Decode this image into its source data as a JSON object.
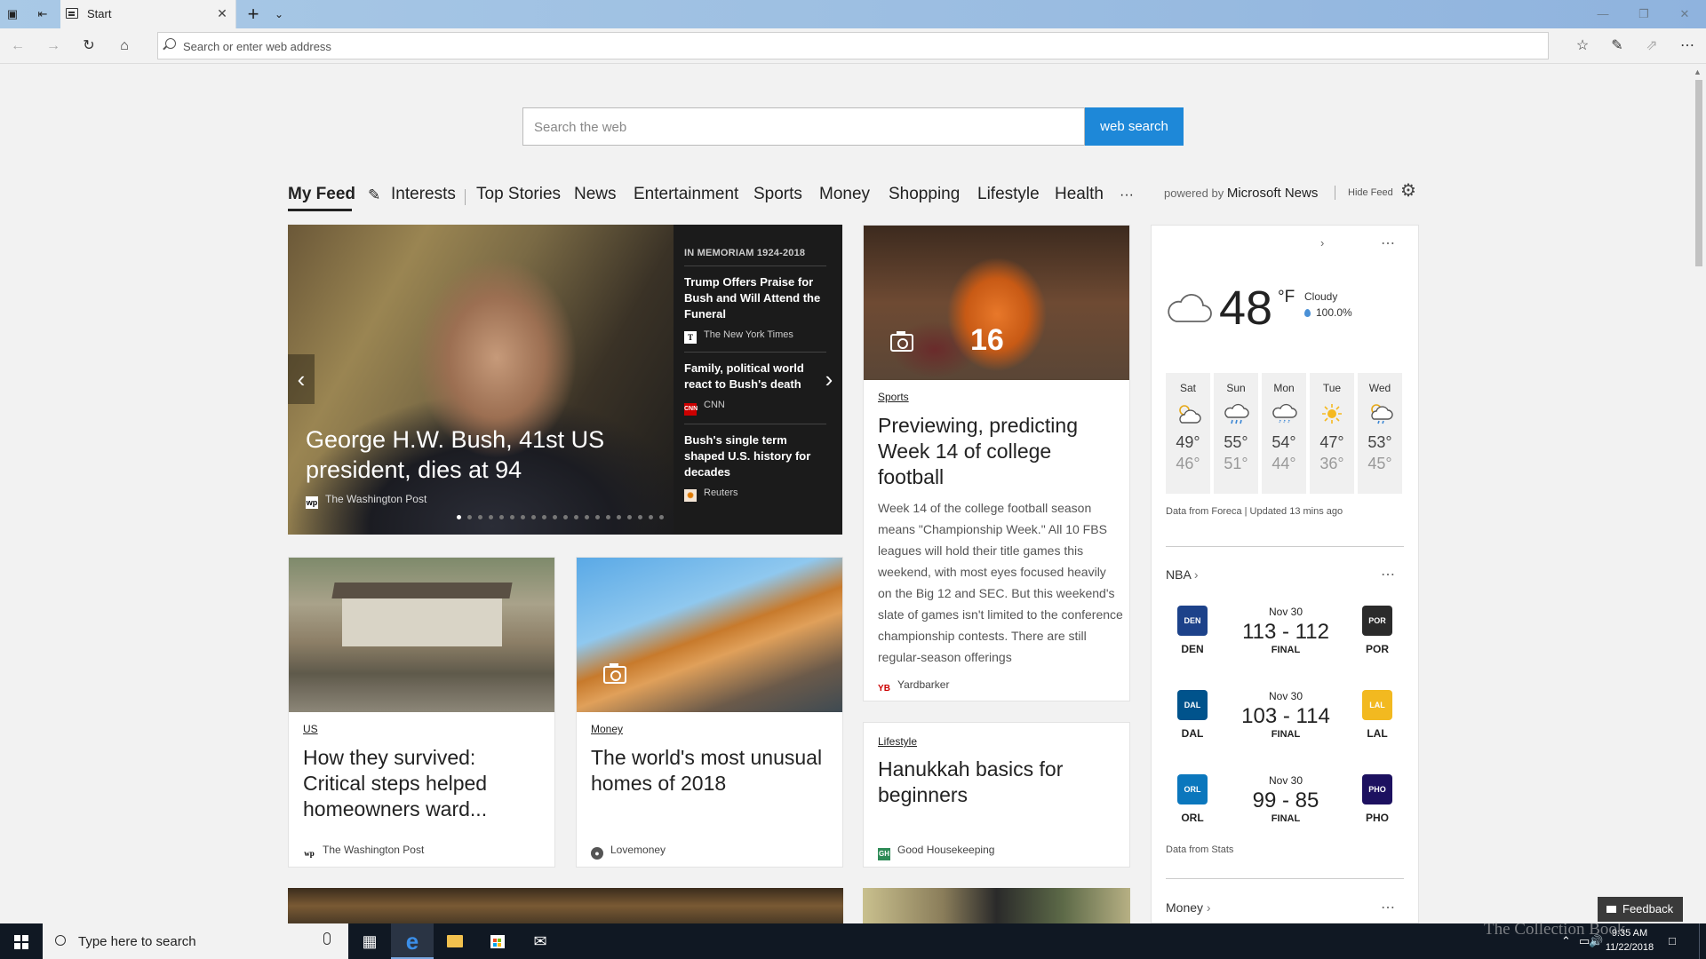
{
  "browser": {
    "tab_title": "Start",
    "address_placeholder": "Search or enter web address",
    "colors": {
      "titlebar": "#9dbfe2",
      "accent": "#1e88d8"
    }
  },
  "search": {
    "placeholder": "Search the web",
    "button_label": "web search"
  },
  "feed_nav": {
    "items": [
      "My Feed",
      "Interests",
      "Top Stories",
      "News",
      "Entertainment",
      "Sports",
      "Money",
      "Shopping",
      "Lifestyle",
      "Health",
      "···"
    ],
    "active": "My Feed",
    "powered_prefix": "powered by",
    "powered_brand": "Microsoft News",
    "hide_feed": "Hide Feed"
  },
  "hero": {
    "title": "George H.W. Bush, 41st US president, dies at 94",
    "source": "The Washington Post",
    "side_category": "IN MEMORIAM 1924-2018",
    "side_items": [
      {
        "title": "Trump Offers Praise for Bush and Will Attend the Funeral",
        "source": "The New York Times"
      },
      {
        "title": "Family, political world react to Bush's death",
        "source": "CNN"
      },
      {
        "title": "Bush's single term shaped U.S. history for decades",
        "source": "Reuters"
      }
    ],
    "carousel_total": 20,
    "carousel_current": 1
  },
  "cards": {
    "sports": {
      "category": "Sports",
      "title": "Previewing, predicting Week 14 of college football",
      "body": "Week 14 of the college football season means \"Championship Week.\" All 10 FBS leagues will hold their title games this weekend, with most eyes focused heavily on the Big 12 and SEC. But this weekend's slate of games isn't limited to the conference championship contests. There are still regular-season offerings",
      "source": "Yardbarker"
    },
    "us": {
      "category": "US",
      "title": "How they survived: Critical steps helped homeowners ward...",
      "source": "The Washington Post"
    },
    "money": {
      "category": "Money",
      "title": "The world's most unusual homes of 2018",
      "source": "Lovemoney"
    },
    "lifestyle": {
      "category": "Lifestyle",
      "title": "Hanukkah basics for beginners",
      "source": "Good Housekeeping"
    }
  },
  "weather": {
    "temp": "48",
    "unit": "°F",
    "condition": "Cloudy",
    "precip": "100.0%",
    "forecast": [
      {
        "day": "Sat",
        "hi": "49°",
        "lo": "46°",
        "icon": "partly-cloudy-icon"
      },
      {
        "day": "Sun",
        "hi": "55°",
        "lo": "51°",
        "icon": "rain-icon"
      },
      {
        "day": "Mon",
        "hi": "54°",
        "lo": "44°",
        "icon": "rain-icon"
      },
      {
        "day": "Tue",
        "hi": "47°",
        "lo": "36°",
        "icon": "sunny-icon"
      },
      {
        "day": "Wed",
        "hi": "53°",
        "lo": "45°",
        "icon": "partly-rain-icon"
      }
    ],
    "source": "Data from Foreca | Updated 13 mins ago"
  },
  "nba": {
    "title": "NBA",
    "games": [
      {
        "date": "Nov 30",
        "score": "113 - 112",
        "status": "FINAL",
        "home": "DEN",
        "away": "POR",
        "home_color": "#1d428a",
        "away_color": "#2b2b2b"
      },
      {
        "date": "Nov 30",
        "score": "103 - 114",
        "status": "FINAL",
        "home": "DAL",
        "away": "LAL",
        "home_color": "#00538c",
        "away_color": "#f2b920"
      },
      {
        "date": "Nov 30",
        "score": "99 - 85",
        "status": "FINAL",
        "home": "ORL",
        "away": "PHO",
        "home_color": "#0b77bd",
        "away_color": "#1d1160"
      }
    ],
    "source": "Data from Stats"
  },
  "money_section": {
    "title": "Money"
  },
  "feedback": {
    "label": "Feedback"
  },
  "taskbar": {
    "search_placeholder": "Type here to search",
    "time": "9:35 AM",
    "date": "11/22/2018"
  },
  "watermark": "The Collection Book"
}
